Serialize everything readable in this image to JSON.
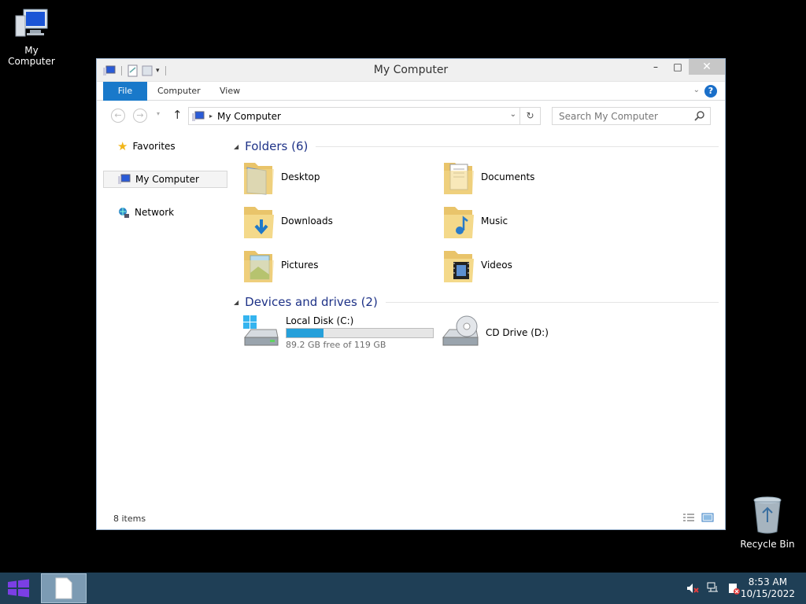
{
  "desktop": {
    "my_computer_label": "My Computer",
    "recycle_bin_label": "Recycle Bin"
  },
  "window": {
    "title": "My Computer",
    "ribbon": {
      "file_tab": "File",
      "computer_tab": "Computer",
      "view_tab": "View",
      "help_label": "?"
    },
    "address": {
      "path": "My Computer"
    },
    "search": {
      "placeholder": "Search My Computer"
    },
    "nav": {
      "favorites": "Favorites",
      "my_computer": "My Computer",
      "network": "Network"
    },
    "folders_group": {
      "header": "Folders (6)",
      "items": [
        {
          "name": "Desktop",
          "icon": "folder-desktop-icon"
        },
        {
          "name": "Documents",
          "icon": "folder-documents-icon"
        },
        {
          "name": "Downloads",
          "icon": "folder-downloads-icon"
        },
        {
          "name": "Music",
          "icon": "folder-music-icon"
        },
        {
          "name": "Pictures",
          "icon": "folder-pictures-icon"
        },
        {
          "name": "Videos",
          "icon": "folder-videos-icon"
        }
      ]
    },
    "devices_group": {
      "header": "Devices and drives (2)",
      "drives": [
        {
          "name": "Local Disk (C:)",
          "free_text": "89.2 GB free of 119 GB",
          "used_fraction": 0.25,
          "icon": "local-disk-icon"
        },
        {
          "name": "CD Drive (D:)",
          "icon": "cd-drive-icon"
        }
      ]
    },
    "status": {
      "item_count": "8 items"
    }
  },
  "taskbar": {
    "time": "8:53 AM",
    "date": "10/15/2022"
  },
  "colors": {
    "accent": "#1979ca",
    "group_header": "#1e3287",
    "taskbar": "#1f3f56",
    "drive_bar": "#26a0da"
  }
}
